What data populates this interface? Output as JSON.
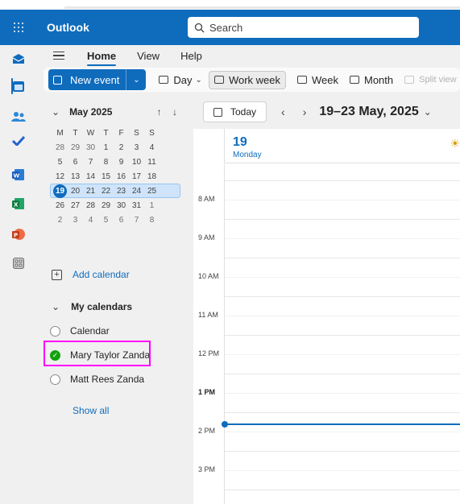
{
  "app": {
    "title": "Outlook"
  },
  "search": {
    "placeholder": "Search"
  },
  "rail": {
    "items": [
      {
        "name": "mail-icon",
        "color": "#0f6cbd"
      },
      {
        "name": "calendar-icon",
        "color": "#0f6cbd"
      },
      {
        "name": "people-icon",
        "color": "#2b88d8"
      },
      {
        "name": "todo-icon",
        "color": "#2564cf"
      },
      {
        "name": "word-icon",
        "color": "#185abd"
      },
      {
        "name": "excel-icon",
        "color": "#107c41"
      },
      {
        "name": "powerpoint-icon",
        "color": "#c43e1c"
      },
      {
        "name": "apps-icon",
        "color": "#616161"
      }
    ]
  },
  "tabs": {
    "home": "Home",
    "view": "View",
    "help": "Help"
  },
  "ribbon": {
    "new_event": "New event",
    "day": "Day",
    "work_week": "Work week",
    "week": "Week",
    "month": "Month",
    "split_view": "Split view"
  },
  "mini_calendar": {
    "month_label": "May 2025",
    "weekdays": [
      "M",
      "T",
      "W",
      "T",
      "F",
      "S",
      "S"
    ],
    "weeks": [
      [
        "28",
        "29",
        "30",
        "1",
        "2",
        "3",
        "4"
      ],
      [
        "5",
        "6",
        "7",
        "8",
        "9",
        "10",
        "11"
      ],
      [
        "12",
        "13",
        "14",
        "15",
        "16",
        "17",
        "18"
      ],
      [
        "19",
        "20",
        "21",
        "22",
        "23",
        "24",
        "25"
      ],
      [
        "26",
        "27",
        "28",
        "29",
        "30",
        "31",
        "1"
      ],
      [
        "2",
        "3",
        "4",
        "5",
        "6",
        "7",
        "8"
      ]
    ]
  },
  "sidebar": {
    "add_calendar": "Add calendar",
    "my_calendars": "My calendars",
    "calendars": [
      "Calendar",
      "Mary Taylor Zanda",
      "Matt Rees Zanda"
    ],
    "show_all": "Show all"
  },
  "calendar": {
    "today_button": "Today",
    "range_label": "19–23 May, 2025",
    "day_number": "19",
    "day_name": "Monday",
    "times": [
      "8 AM",
      "9 AM",
      "10 AM",
      "11 AM",
      "12 PM",
      "1 PM",
      "2 PM",
      "3 PM"
    ]
  }
}
